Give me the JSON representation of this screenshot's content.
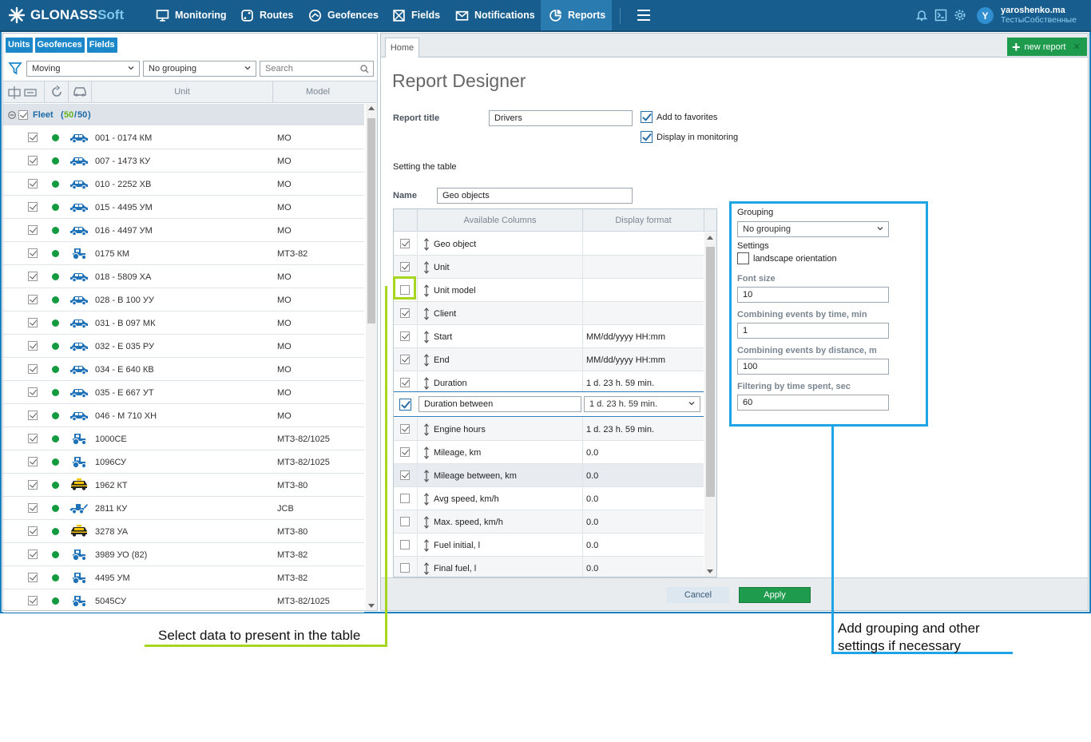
{
  "app": {
    "logo_main": "GLONASS",
    "logo_soft": "Soft",
    "nav": [
      {
        "label": "Monitoring",
        "icon": "monitor-icon"
      },
      {
        "label": "Routes",
        "icon": "route-icon"
      },
      {
        "label": "Geofences",
        "icon": "geofence-icon"
      },
      {
        "label": "Fields",
        "icon": "field-icon"
      },
      {
        "label": "Notifications",
        "icon": "mail-icon"
      },
      {
        "label": "Reports",
        "icon": "report-icon",
        "active": true
      }
    ],
    "user_initial": "Y",
    "user_name": "yaroshenko.ma",
    "user_org": "ТестыСобственные"
  },
  "left_panel": {
    "tabs": [
      "Units",
      "Geofences",
      "Fields"
    ],
    "filter_value": "Moving",
    "grouping_value": "No grouping",
    "search_placeholder": "Search",
    "col_unit": "Unit",
    "col_model": "Model",
    "fleet_label": "Fleet",
    "fleet_count_a": "50",
    "fleet_sep": "/",
    "fleet_count_b": "50",
    "units": [
      {
        "name": "001 - 0174 КМ",
        "model": "МО",
        "icon": "car"
      },
      {
        "name": "007 - 1473 КУ",
        "model": "МО",
        "icon": "car"
      },
      {
        "name": "010 - 2252 ХВ",
        "model": "МО",
        "icon": "car"
      },
      {
        "name": "015 - 4495 УМ",
        "model": "МО",
        "icon": "car"
      },
      {
        "name": "016 - 4497 УМ",
        "model": "МО",
        "icon": "car"
      },
      {
        "name": "0175 КМ",
        "model": "МТЗ-82",
        "icon": "tractor"
      },
      {
        "name": "018 - 5809 ХА",
        "model": "МО",
        "icon": "car"
      },
      {
        "name": "028 - В 100 УУ",
        "model": "МО",
        "icon": "car"
      },
      {
        "name": "031 - В 097 МК",
        "model": "МО",
        "icon": "car"
      },
      {
        "name": "032 - Е 035 РУ",
        "model": "МО",
        "icon": "car"
      },
      {
        "name": "034 - Е 640 КВ",
        "model": "МО",
        "icon": "car"
      },
      {
        "name": "035 - Е 667 УТ",
        "model": "МО",
        "icon": "car"
      },
      {
        "name": "046 - М 710 ХН",
        "model": "МО",
        "icon": "car"
      },
      {
        "name": "1000СЕ",
        "model": "МТЗ-82/1025",
        "icon": "tractor"
      },
      {
        "name": "1096СУ",
        "model": "МТЗ-82/1025",
        "icon": "tractor"
      },
      {
        "name": "1962 КТ",
        "model": "МТЗ-80",
        "icon": "taxi"
      },
      {
        "name": "2811 КУ",
        "model": "JCB",
        "icon": "loader"
      },
      {
        "name": "3278 УА",
        "model": "МТЗ-80",
        "icon": "taxi"
      },
      {
        "name": "3989 УО (82)",
        "model": "МТЗ-82",
        "icon": "tractor"
      },
      {
        "name": "4495 УМ",
        "model": "МТЗ-82",
        "icon": "tractor"
      },
      {
        "name": "5045СУ",
        "model": "МТЗ-82/1025",
        "icon": "tractor"
      }
    ]
  },
  "designer": {
    "home_tab": "Home",
    "new_report": "new report",
    "title": "Report Designer",
    "report_title_label": "Report title",
    "report_title_value": "Drivers",
    "add_favorites": "Add to favorites",
    "display_monitoring": "Display in monitoring",
    "setting_table": "Setting the table",
    "name_label": "Name",
    "name_value": "Geo objects",
    "col_available": "Available Columns",
    "col_format": "Display format",
    "columns": [
      {
        "name": "Geo object",
        "format": "",
        "checked": true
      },
      {
        "name": "Unit",
        "format": "",
        "checked": true
      },
      {
        "name": "Unit model",
        "format": "",
        "checked": false
      },
      {
        "name": "Client",
        "format": "",
        "checked": true
      },
      {
        "name": "Start",
        "format": "MM/dd/yyyy HH:mm",
        "checked": true
      },
      {
        "name": "End",
        "format": "MM/dd/yyyy HH:mm",
        "checked": true
      },
      {
        "name": "Duration",
        "format": "1 d. 23 h. 59 min.",
        "checked": true
      }
    ],
    "edit_row": {
      "name": "Duration between",
      "format": "1 d. 23 h. 59 min."
    },
    "columns2": [
      {
        "name": "Engine hours",
        "format": "1 d. 23 h. 59 min.",
        "checked": true
      },
      {
        "name": "Mileage, km",
        "format": "0.0",
        "checked": true
      },
      {
        "name": "Mileage between, km",
        "format": "0.0",
        "checked": true
      },
      {
        "name": "Avg speed, km/h",
        "format": "0.0",
        "checked": false
      },
      {
        "name": "Max. speed, km/h",
        "format": "0.0",
        "checked": false
      },
      {
        "name": "Fuel initial, l",
        "format": "0.0",
        "checked": false
      },
      {
        "name": "Final fuel, l",
        "format": "0.0",
        "checked": false
      }
    ],
    "grouping_label": "Grouping",
    "grouping_value": "No grouping",
    "settings_label": "Settings",
    "landscape": "landscape orientation",
    "font_size_label": "Font size",
    "font_size_value": "10",
    "comb_time_label": "Combining events by time, min",
    "comb_time_value": "1",
    "comb_dist_label": "Combining events by distance, m",
    "comb_dist_value": "100",
    "filter_time_label": "Filtering by time spent, sec",
    "filter_time_value": "60",
    "cancel": "Cancel",
    "apply": "Apply"
  },
  "annotations": {
    "green": "Select data to present in the table",
    "blue_1": "Add grouping and other",
    "blue_2": "settings if necessary"
  }
}
